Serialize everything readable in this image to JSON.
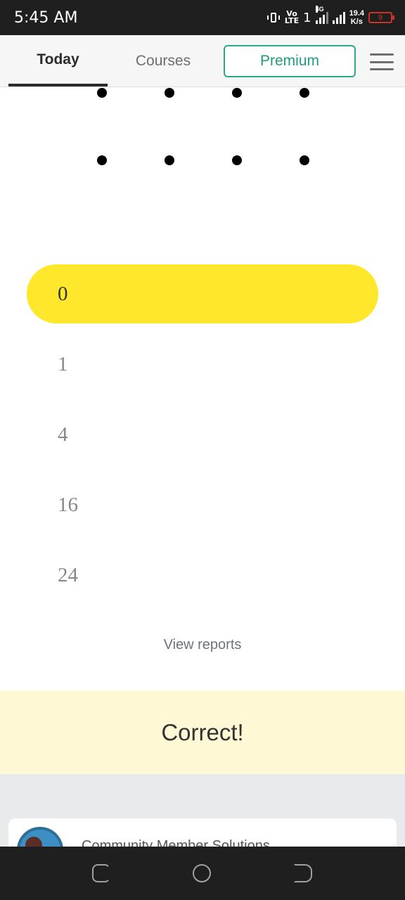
{
  "status_bar": {
    "time": "5:45 AM",
    "volte": "Vo\nLTE",
    "sim": "1",
    "network": "4G",
    "speed": "19.4\nK/s",
    "battery": "9",
    "icons": [
      "vibrate-icon",
      "volte-icon",
      "signal-icon",
      "battery-icon"
    ]
  },
  "nav": {
    "tab_today": "Today",
    "tab_courses": "Courses",
    "premium": "Premium",
    "menu_icon": "hamburger-menu-icon"
  },
  "answers": [
    {
      "label": "0",
      "selected": true
    },
    {
      "label": "1",
      "selected": false
    },
    {
      "label": "4",
      "selected": false
    },
    {
      "label": "16",
      "selected": false
    },
    {
      "label": "24",
      "selected": false
    }
  ],
  "view_reports": "View reports",
  "feedback": "Correct!",
  "card": {
    "text": "Community Member Solutions"
  },
  "colors": {
    "selected_answer": "#ffe82b",
    "premium_accent": "#1f9c7d",
    "feedback_bg": "#fff8d4"
  }
}
